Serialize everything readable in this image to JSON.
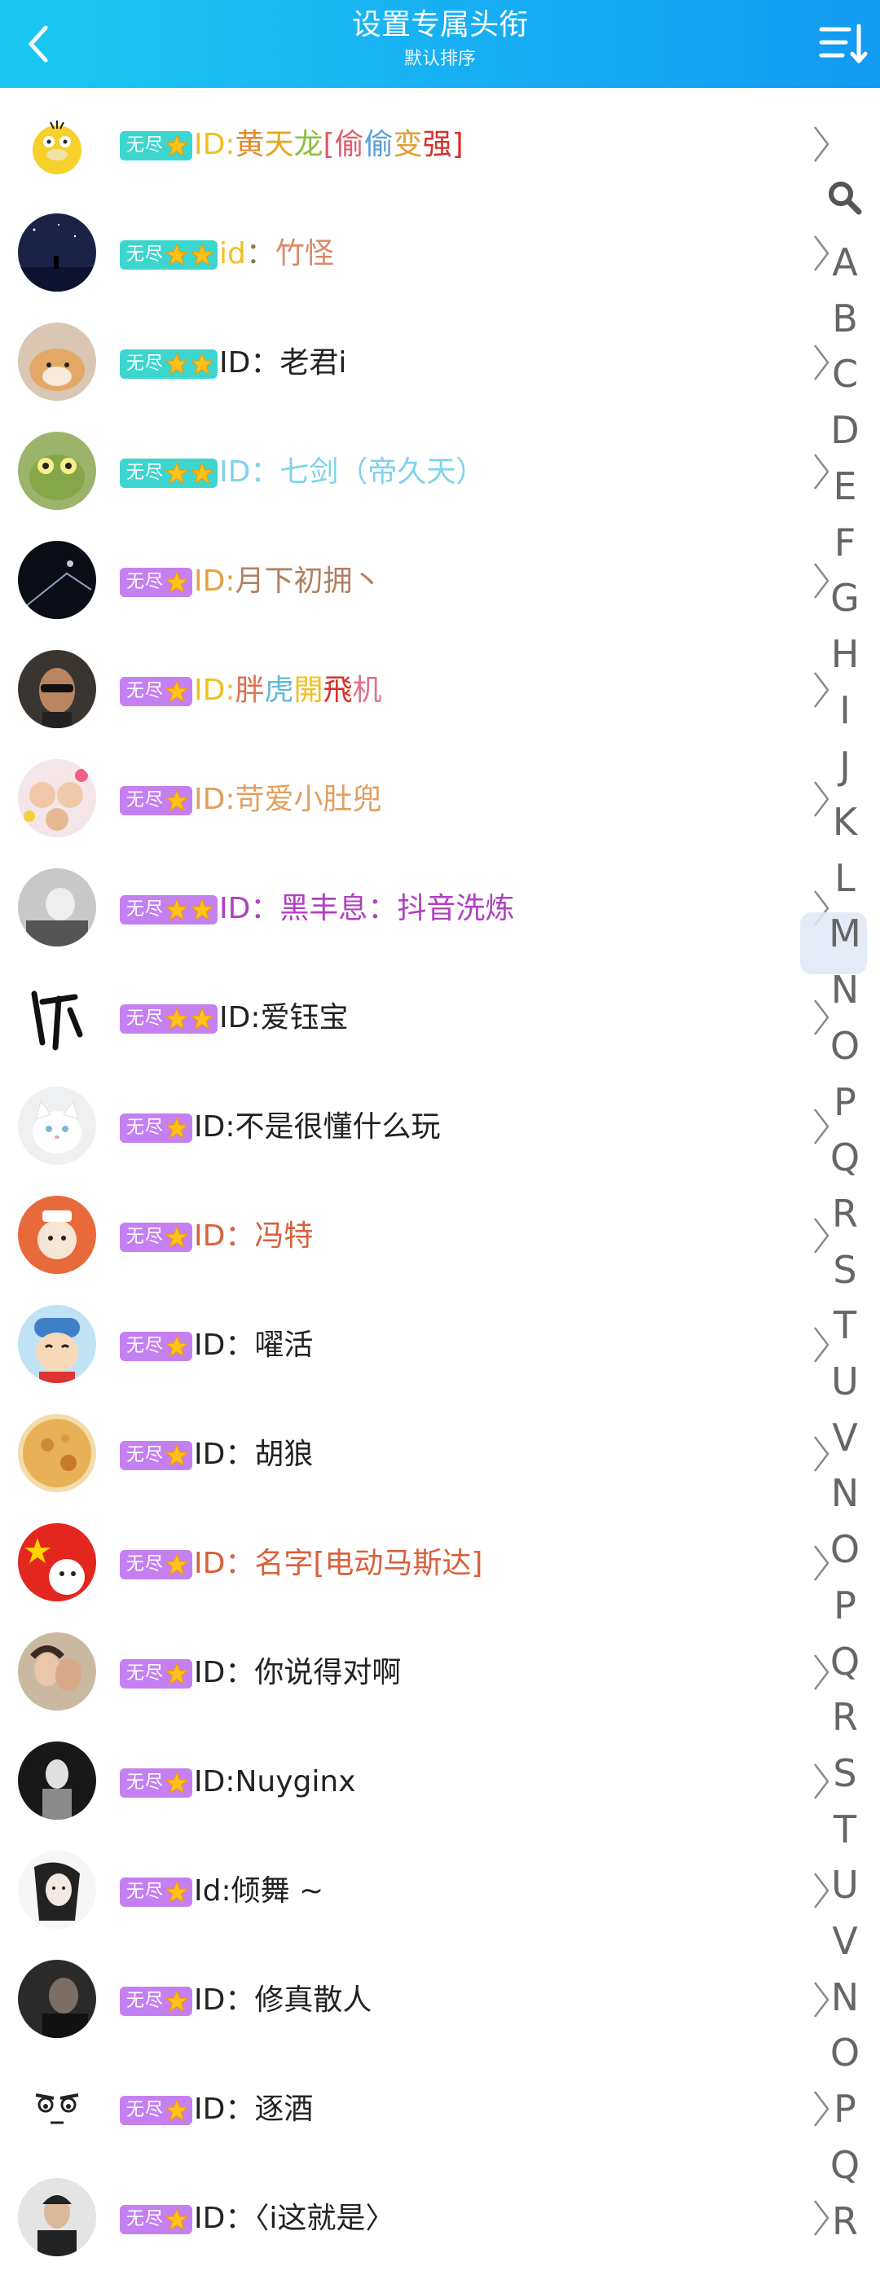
{
  "header": {
    "title": "设置专属头衔",
    "subtitle": "默认排序"
  },
  "badge_text": "无尽",
  "rows": [
    {
      "badge": "teal",
      "stars": 1,
      "avatar": "yellow-duck",
      "segments": [
        [
          "ID:",
          "#f0c020"
        ],
        [
          "黄",
          "#e08b2a"
        ],
        [
          "天",
          "#e6a51e"
        ],
        [
          "龙",
          "#8cbf3c"
        ],
        [
          "[偷",
          "#e05a6a"
        ],
        [
          "偷",
          "#5aa0d8"
        ],
        [
          "变",
          "#e0a030"
        ],
        [
          "强]",
          "#d9302a"
        ]
      ]
    },
    {
      "badge": "teal",
      "stars": 2,
      "avatar": "night-sky",
      "segments": [
        [
          "id",
          "#f0c020"
        ],
        [
          "：",
          "#8a7a50"
        ],
        [
          "竹怪",
          "#d98a6a"
        ]
      ]
    },
    {
      "badge": "teal",
      "stars": 2,
      "avatar": "shiba-dog",
      "segments": [
        [
          "ID：老君i",
          "#222222"
        ]
      ]
    },
    {
      "badge": "teal",
      "stars": 2,
      "avatar": "green-frog",
      "segments": [
        [
          "ID：七剑（帝久天）",
          "#7fd3ea"
        ]
      ]
    },
    {
      "badge": "purple",
      "stars": 1,
      "avatar": "dark-night",
      "segments": [
        [
          "ID:",
          "#e8a040"
        ],
        [
          "月下初拥丶",
          "#b08060"
        ]
      ]
    },
    {
      "badge": "purple",
      "stars": 1,
      "avatar": "sunglasses-man",
      "segments": [
        [
          "ID:",
          "#f0c020"
        ],
        [
          "胖",
          "#e07050"
        ],
        [
          "虎",
          "#60b8d8"
        ],
        [
          "開",
          "#f0c020"
        ],
        [
          "飛",
          "#d9302a"
        ],
        [
          "机",
          "#e0708a"
        ]
      ]
    },
    {
      "badge": "purple",
      "stars": 1,
      "avatar": "cute-girl",
      "segments": [
        [
          "ID:苛爱小肚兜",
          "#e0a060"
        ]
      ]
    },
    {
      "badge": "purple",
      "stars": 2,
      "avatar": "gray-photo",
      "segments": [
        [
          "ID：黑丰息：抖音洗炼",
          "#b040c0"
        ]
      ]
    },
    {
      "badge": "purple",
      "stars": 2,
      "avatar": "calligraphy",
      "segments": [
        [
          "ID:爱钰宝",
          "#222222"
        ]
      ]
    },
    {
      "badge": "purple",
      "stars": 1,
      "avatar": "white-cat",
      "segments": [
        [
          "ID:不是很懂什么玩",
          "#222222"
        ]
      ]
    },
    {
      "badge": "purple",
      "stars": 1,
      "avatar": "cartoon-orange",
      "segments": [
        [
          "ID：冯特",
          "#d9603a"
        ]
      ]
    },
    {
      "badge": "purple",
      "stars": 1,
      "avatar": "shin-chan",
      "segments": [
        [
          "ID：嚁活",
          "#222222"
        ]
      ]
    },
    {
      "badge": "purple",
      "stars": 1,
      "avatar": "planet",
      "segments": [
        [
          "ID：胡狼",
          "#222222"
        ]
      ]
    },
    {
      "badge": "purple",
      "stars": 1,
      "avatar": "china-flag",
      "segments": [
        [
          "ID：名字[电动马斯达]",
          "#d9603a"
        ]
      ]
    },
    {
      "badge": "purple",
      "stars": 1,
      "avatar": "couple-photo",
      "segments": [
        [
          "ID：你说得对啊",
          "#222222"
        ]
      ]
    },
    {
      "badge": "purple",
      "stars": 1,
      "avatar": "dark-figure",
      "segments": [
        [
          "ID:Nuyginx",
          "#222222"
        ]
      ]
    },
    {
      "badge": "purple",
      "stars": 1,
      "avatar": "anime-sketch",
      "segments": [
        [
          "Id:倾舞 ~",
          "#222222"
        ]
      ]
    },
    {
      "badge": "purple",
      "stars": 1,
      "avatar": "dark-portrait",
      "segments": [
        [
          "ID：修真散人",
          "#222222"
        ]
      ]
    },
    {
      "badge": "purple",
      "stars": 1,
      "avatar": "face-emoji",
      "segments": [
        [
          "ID：逐酒",
          "#222222"
        ]
      ]
    },
    {
      "badge": "purple",
      "stars": 1,
      "avatar": "boy-photo",
      "segments": [
        [
          "ID：〈i这就是〉",
          "#222222"
        ]
      ]
    }
  ],
  "index_letters": [
    "A",
    "B",
    "C",
    "D",
    "E",
    "F",
    "G",
    "H",
    "I",
    "J",
    "K",
    "L",
    "M",
    "N",
    "O",
    "P",
    "Q",
    "R",
    "S",
    "T",
    "U",
    "V",
    "N",
    "O",
    "P",
    "Q",
    "R",
    "S",
    "T",
    "U",
    "V",
    "N",
    "O",
    "P",
    "Q",
    "R"
  ],
  "colors": {
    "header_start": "#1bc8f2",
    "header_end": "#129bf2",
    "badge_teal": "#3cd6cf",
    "badge_purple": "#c480f0",
    "star": "#ffc21a"
  }
}
